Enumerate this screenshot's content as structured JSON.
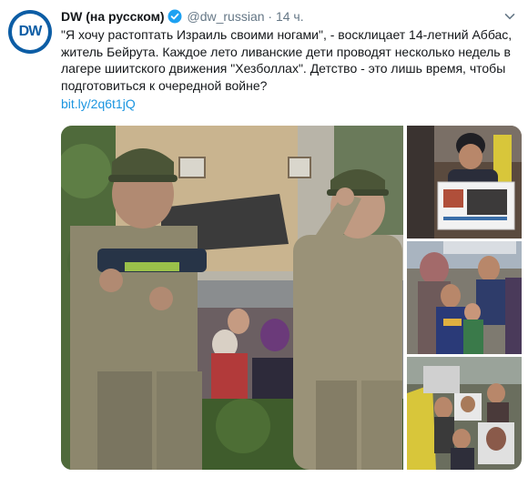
{
  "tweet": {
    "display_name": "DW (на русском)",
    "handle": "@dw_russian",
    "separator": "·",
    "time": "14 ч.",
    "text": "\"Я хочу растоптать Израиль своими ногами\", - восклицает 14-летний Аббас, житель Бейрута. Каждое лето ливанские дети проводят несколько недель в лагере шиитского движения \"Хезболлах\". Детство - это лишь время, чтобы подготовиться к очередной войне?",
    "link": "bit.ly/2q6t1jQ",
    "logo_text": "DW"
  },
  "media": {
    "photos": [
      {
        "name": "photo-main",
        "subject": "two children in camouflage uniforms, one holding a toy rifle, one saluting"
      },
      {
        "name": "photo-top-right",
        "subject": "boy holding poster at rally"
      },
      {
        "name": "photo-middle-right",
        "subject": "children in crowd, one in USPA sweatshirt"
      },
      {
        "name": "photo-bottom-right",
        "subject": "crowd holding portraits and yellow flags"
      }
    ]
  },
  "colors": {
    "brand": "#0c5da5",
    "link": "#1b95e0",
    "verified": "#1da1f2",
    "text": "#14171a",
    "secondary": "#657786"
  },
  "icons": [
    "dw-logo",
    "verified-badge-icon",
    "more-options-chevron-icon"
  ]
}
